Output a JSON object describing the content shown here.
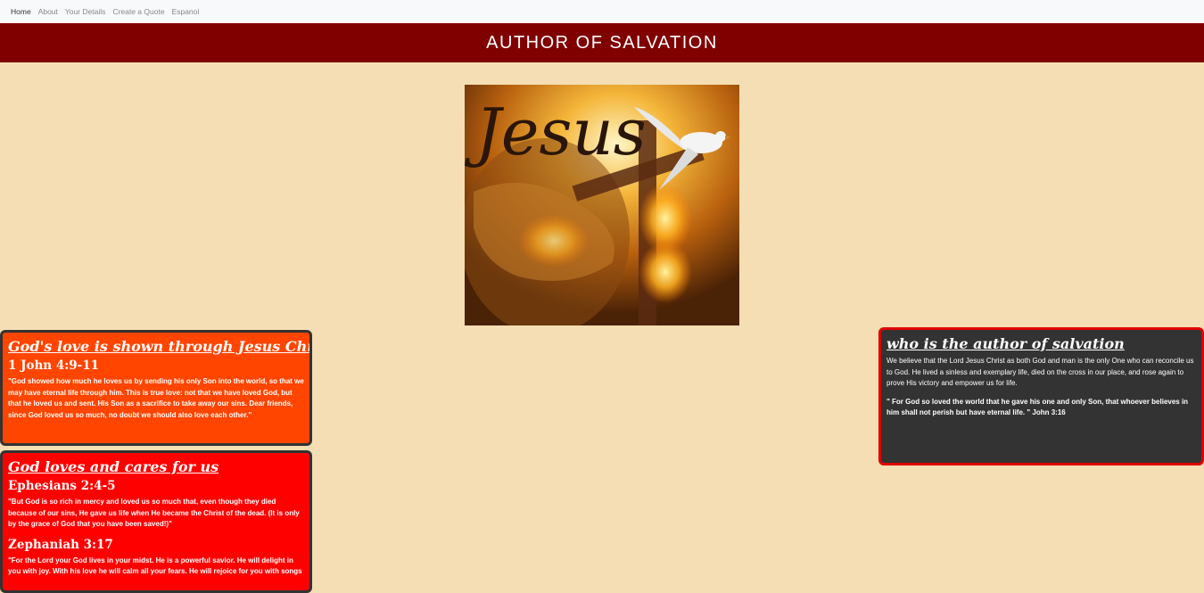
{
  "nav": {
    "items": [
      {
        "label": "Home"
      },
      {
        "label": "About"
      },
      {
        "label": "Your Details"
      },
      {
        "label": "Create a Quote"
      },
      {
        "label": "Espanol"
      }
    ]
  },
  "banner": {
    "title": "AUTHOR OF SALVATION"
  },
  "hero": {
    "script_text": "Jesus"
  },
  "cards": {
    "love_shown": {
      "title": "God's love is shown through Jesus Christ",
      "reference": "1 John 4:9-11",
      "text": "\"God showed how much he loves us by sending his only Son into the world, so that we may have eternal life through him. This is true love: not that we have loved God, but that he loved us and sent. His Son as a sacrifice to take away our sins. Dear friends, since God loved us so much, no doubt we should also love each other.\""
    },
    "loves_cares": {
      "title": "God loves and cares for us",
      "reference1": "Ephesians 2:4-5",
      "text1": "\"But God is so rich in mercy and loved us so much that, even though they died because of our sins, He gave us life when He became the Christ of the dead. (It is only by the grace of God that you have been saved!)\"",
      "reference2": "Zephaniah 3:17",
      "text2": "\"For the Lord your God lives in your midst. He is a powerful savior. He will delight in you with joy. With his love he will calm all your fears. He will rejoice for you with songs"
    },
    "author": {
      "title": "who is the author of salvation",
      "text1": "We believe that the Lord Jesus Christ as both God and man is the only One who can reconcile us to God. He lived a sinless and exemplary life, died on the cross in our place, and rose again to prove His victory and empower us for life.",
      "text2": "\" For God so loved the world that he gave his one and only Son, that whoever believes in him shall not perish but have eternal life. \" John 3:16"
    }
  },
  "colors": {
    "page_bg": "#f5deb3",
    "banner_bg": "#800000",
    "card1_bg": "#ff4500",
    "card2_bg": "#ff0000",
    "card3_bg": "#333333",
    "card3_border": "#e00000"
  }
}
